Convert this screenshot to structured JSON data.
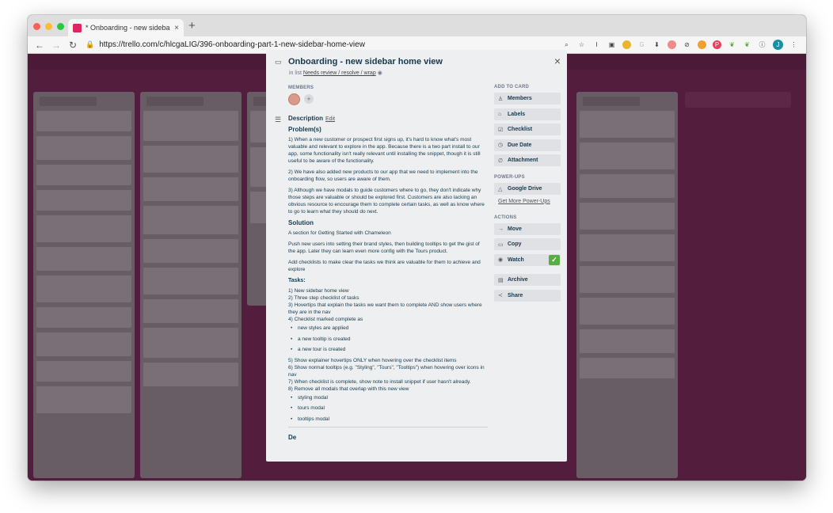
{
  "browser": {
    "tab_title": "* Onboarding - new sidebar ho",
    "tab_close": "×",
    "new_tab": "+",
    "url": "https://trello.com/c/hlcgaLIG/396-onboarding-part-1-new-sidebar-home-view",
    "account_initial": "J",
    "colors": {
      "close": "#fc5f57",
      "minimize": "#fdbc2e",
      "maximize": "#29c840"
    }
  },
  "card": {
    "title": "Onboarding - new sidebar home view",
    "in_list_prefix": "in list",
    "list_name": "Needs review / resolve / wrap",
    "members_label": "MEMBERS",
    "add_member": "+",
    "description_label": "Description",
    "edit_label": "Edit",
    "problems_heading": "Problem(s)",
    "p1": "1) When a new customer or prospect first signs up, it's hard to know what's most valuable and relevant to explore in the app. Because there is a two part install to our app, some functionality isn't really relevant until installing the snippet, though it is still useful to be aware of the functionality.",
    "p2": "2) We have also added new products to our app that we need to implement into the onboarding flow, so users are aware of them.",
    "p3": "3) Although we have modals to guide customers where to go, they don't indicate why those steps are valuable or should be explored first. Customers are also lacking an obvious resource to encourage them to complete certain tasks, as well as know where to go to learn what they should do next.",
    "solution_heading": "Solution",
    "s1": "A section for Getting Started with Chameleon",
    "s2": "Push new users into setting their brand styles, then building tooltips to get the gist of the app. Later they can learn even more config with the Tours product.",
    "s3": "Add checklists to make clear the tasks we think are valuable for them to achieve and explore",
    "tasks_heading": "Tasks:",
    "t1": "1) New sidebar home view",
    "t2": "2) Three step checklist of tasks",
    "t3": "3) Hovertips that explain the tasks we want them to complete AND show users where they are in the nav",
    "t4": "4) Checklist marked complete as",
    "t4_items": [
      "new styles are applied",
      "a new tooltip is created",
      "a new tour is created"
    ],
    "t5": "5) Show explainer hovertips ONLY when hovering over the checklist items",
    "t6": "6) Show normal tooltips (e.g. \"Styling\", \"Tours\", \"Tooltips\") when hovering over icons in nav",
    "t7": "7) When checklist is complete, show note to install snippet if user hasn't already.",
    "t8": "8) Remove all modals that overlap with this new view",
    "t8_items": [
      "styling modal",
      "tours modal",
      "tooltips modal"
    ],
    "truncated_heading": "De",
    "close": "×"
  },
  "sidebar": {
    "add_to_card": "ADD TO CARD",
    "members": "Members",
    "labels": "Labels",
    "checklist": "Checklist",
    "due_date": "Due Date",
    "attachment": "Attachment",
    "power_ups": "POWER-UPS",
    "google_drive": "Google Drive",
    "get_more": "Get More Power-Ups",
    "actions": "ACTIONS",
    "move": "Move",
    "copy": "Copy",
    "watch": "Watch",
    "archive": "Archive",
    "share": "Share"
  }
}
